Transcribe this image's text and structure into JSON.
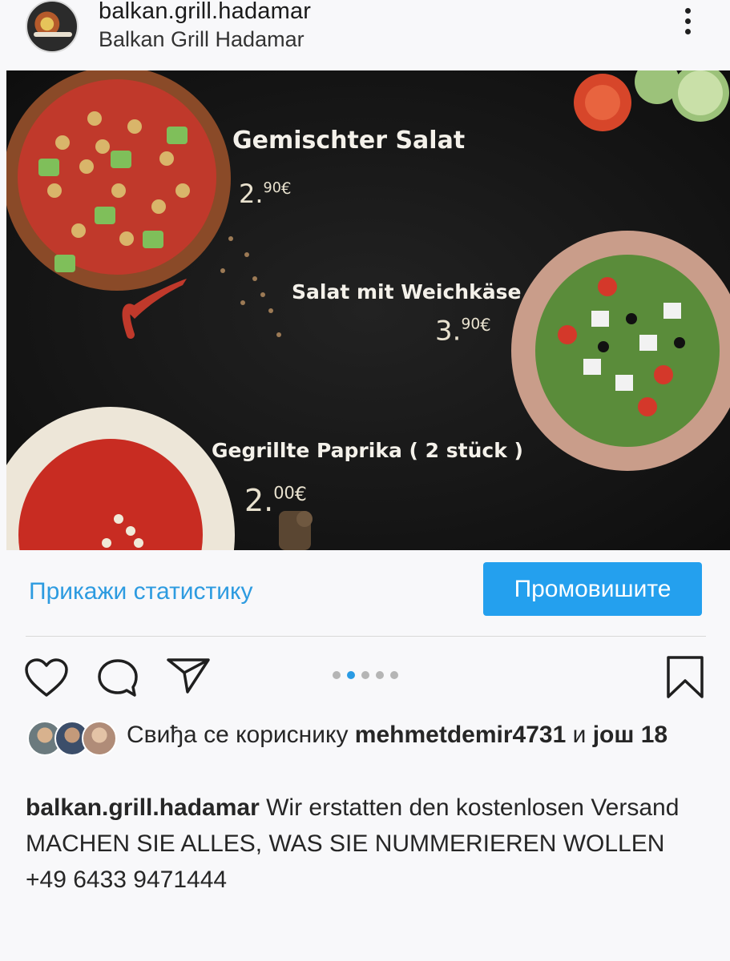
{
  "header": {
    "username": "balkan.grill.hadamar",
    "subtitle": "Balkan Grill Hadamar"
  },
  "post_image": {
    "items": [
      {
        "name": "Gemischter Salat",
        "price_main": "2.",
        "price_cents": "90",
        "currency": "€"
      },
      {
        "name": "Salat mit Weichkäse",
        "price_main": "3.",
        "price_cents": "90",
        "currency": "€"
      },
      {
        "name": "Gegrillte Paprika ( 2 stück )",
        "price_main": "2.",
        "price_cents": "00",
        "currency": "€"
      }
    ]
  },
  "actions": {
    "stats_link": "Прикажи статистику",
    "promote_label": "Промовишите"
  },
  "carousel": {
    "count": 5,
    "active_index": 1
  },
  "likes": {
    "prefix": "Свиђа се кориснику ",
    "user": "mehmetdemir4731",
    "middle": " и ",
    "suffix": "још 18"
  },
  "caption": {
    "username": "balkan.grill.hadamar",
    "line1": " Wir erstatten den kostenlosen Versand",
    "line2": "MACHEN SIE ALLES, WAS SIE NUMMERIEREN WOLLEN",
    "line3": "+49 6433 9471444"
  },
  "colors": {
    "accent": "#24a0ee",
    "link": "#2d9be0",
    "background": "#f8f8fa"
  }
}
